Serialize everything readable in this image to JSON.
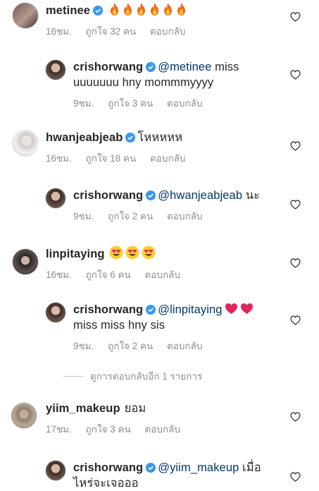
{
  "comments": [
    {
      "username": "metinee",
      "text": "",
      "emoji": [
        "fire",
        "fire",
        "fire",
        "fire",
        "fire",
        "fire"
      ],
      "time": "16ชม.",
      "likes": "ถูกใจ 32 คน",
      "reply_label": "ตอบกลับ"
    },
    {
      "username": "crishorwang",
      "mention": "@metinee",
      "text_line1": " miss",
      "text_line2": "uuuuuuu hny mommmyyyy",
      "time": "9ชม.",
      "likes": "ถูกใจ 3 คน",
      "reply_label": "ตอบกลับ"
    },
    {
      "username": "hwanjeabjeab",
      "text": "โหหหหห",
      "time": "16ชม.",
      "likes": "ถูกใจ 18 คน",
      "reply_label": "ตอบกลับ"
    },
    {
      "username": "crishorwang",
      "mention": "@hwanjeabjeab",
      "text": " นะ",
      "time": "9ชม.",
      "likes": "ถูกใจ 2 คน",
      "reply_label": "ตอบกลับ"
    },
    {
      "username": "linpitaying",
      "emoji": [
        "heart-eyes",
        "heart-eyes",
        "heart-eyes"
      ],
      "time": "16ชม.",
      "likes": "ถูกใจ 6 คน",
      "reply_label": "ตอบกลับ"
    },
    {
      "username": "crishorwang",
      "mention": "@linpitaying",
      "emoji": [
        "red-heart",
        "red-heart"
      ],
      "text_line2": "miss miss hny sis",
      "time": "9ชม.",
      "likes": "ถูกใจ 2 คน",
      "reply_label": "ตอบกลับ"
    },
    {
      "username": "yiim_makeup",
      "text": "ยอม",
      "time": "17ชม.",
      "likes": "ถูกใจ 3 คน",
      "reply_label": "ตอบกลับ"
    },
    {
      "username": "crishorwang",
      "mention": "@yiim_makeup",
      "text_line1": " เมื่อ",
      "text_line2": "ไหร่จะเจอออ"
    }
  ],
  "view_more_replies": "ดูการตอบกลับอีก 1 รายการ",
  "colors": {
    "mention": "#00376b",
    "meta": "#8e8e8e",
    "verified": "#3897f0"
  }
}
